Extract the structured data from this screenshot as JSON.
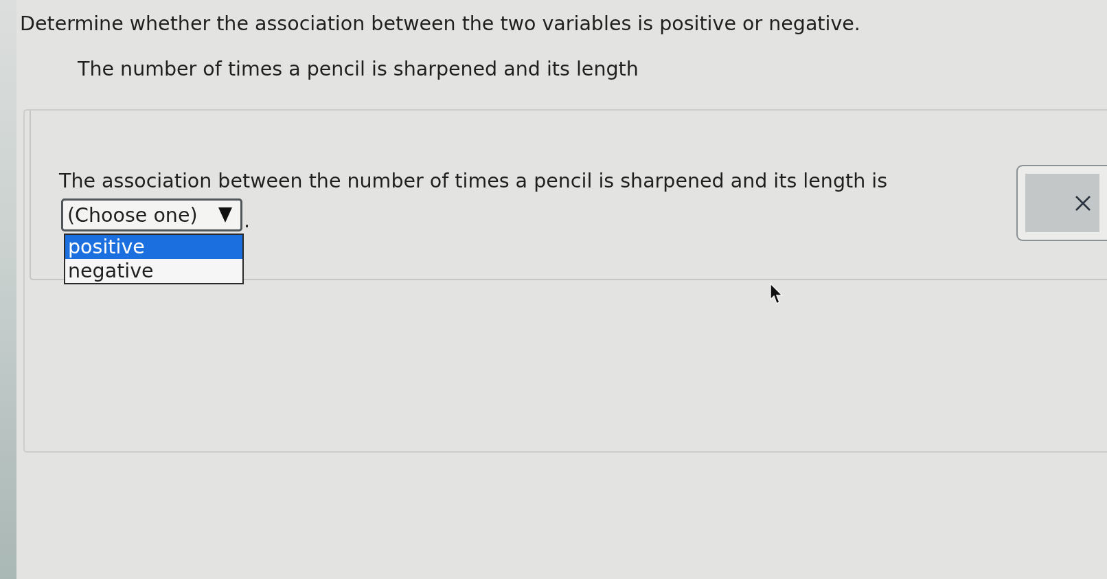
{
  "instruction": "Determine whether the association between the two variables is positive or negative.",
  "prompt": "The number of times a pencil is sharpened and its length",
  "answer": {
    "sentence": "The association between the number of times a pencil is sharpened and its length is",
    "dropdown": {
      "placeholder": "(Choose one)",
      "expanded": true,
      "options": [
        {
          "label": "positive",
          "selected": true
        },
        {
          "label": "negative",
          "selected": false
        }
      ]
    },
    "end_mark": "."
  }
}
